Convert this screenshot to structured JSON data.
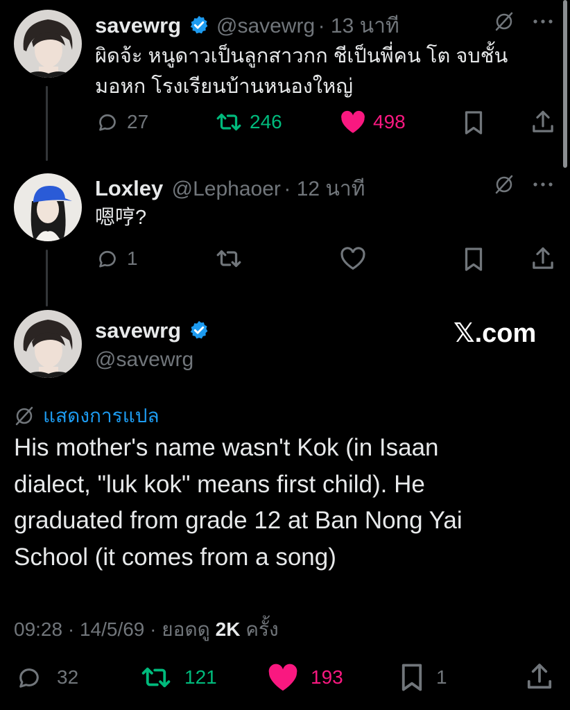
{
  "reply1": {
    "name": "savewrg",
    "handle": "@savewrg",
    "time": "· 13 นาที",
    "text_line1": "ผิดจ้ะ หนูดาวเป็นลูกสาวกก ชีเป็นพี่คน โต จบชั้น",
    "text_line2": "มอหก โรงเรียนบ้านหนองใหญ่",
    "replies": "27",
    "reposts": "246",
    "likes": "498"
  },
  "reply2": {
    "name": "Loxley",
    "handle": "@Lephaoer",
    "time": "· 12 นาที",
    "text": "嗯哼?",
    "replies": "1"
  },
  "main": {
    "name": "savewrg",
    "handle": "@savewrg",
    "watermark": "𝕏.com",
    "translate_label": "แสดงการแปล",
    "text_line1": "His mother's name wasn't Kok (in Isaan",
    "text_line2": "dialect, \"luk kok\" means first child). He",
    "text_line3": "graduated from grade 12 at Ban Nong Yai",
    "text_line4": "School (it comes from a song)",
    "time_prefix": "09:28 · 14/5/69 · ยอดดู ",
    "views": "2K",
    "views_suffix": " ครั้ง",
    "replies": "32",
    "reposts": "121",
    "likes": "193",
    "bookmarks": "1"
  },
  "colors": {
    "background": "#000000",
    "text": "#e7e9ea",
    "secondary": "#71767b",
    "repost_green": "#00ba7c",
    "like_pink": "#f91880",
    "verified_blue": "#1d9bf0",
    "link_blue": "#1d9bf0"
  }
}
